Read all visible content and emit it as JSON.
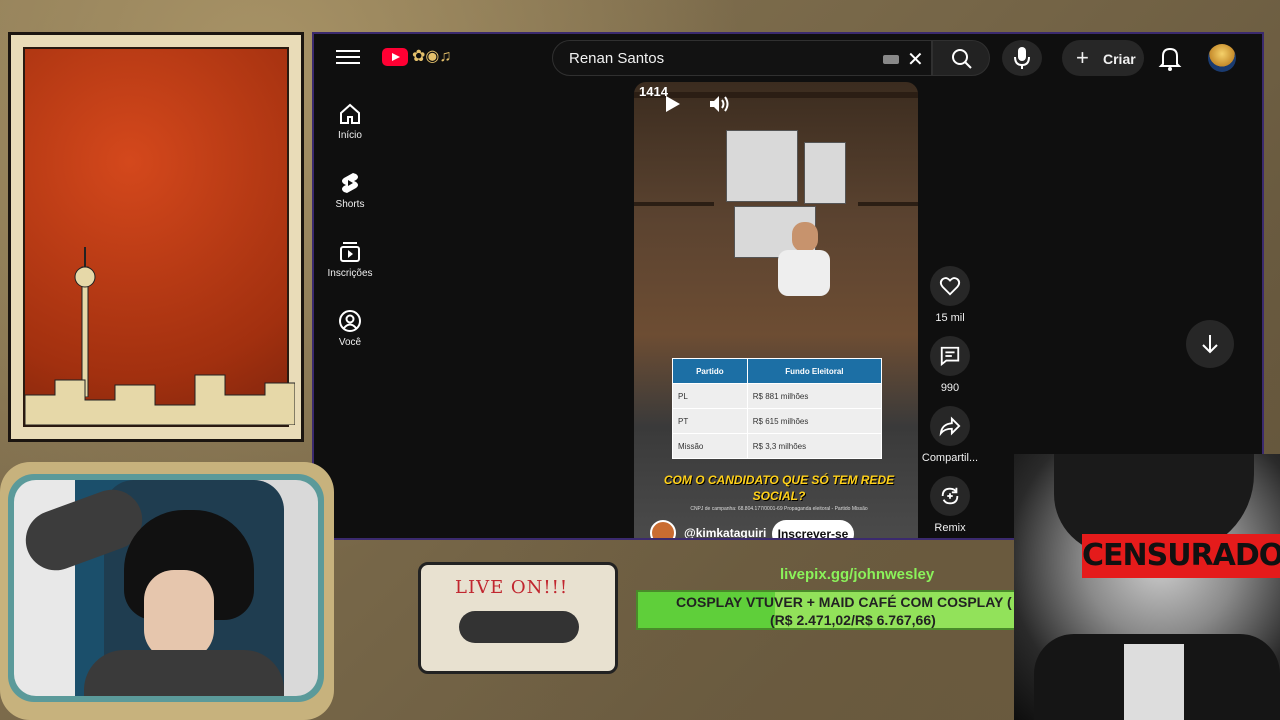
{
  "youtube": {
    "search": {
      "value": "Renan Santos"
    },
    "create_label": "Criar",
    "sidebar": [
      {
        "label": "Início",
        "icon": "home-icon"
      },
      {
        "label": "Shorts",
        "icon": "shorts-icon"
      },
      {
        "label": "Inscrições",
        "icon": "subscriptions-icon"
      },
      {
        "label": "Você",
        "icon": "you-icon"
      }
    ],
    "short": {
      "overlay_number": "1414",
      "table": {
        "headers": [
          "Partido",
          "Fundo Eleitoral"
        ],
        "rows": [
          [
            "PL",
            "R$ 881 milhões"
          ],
          [
            "PT",
            "R$ 615 milhões"
          ],
          [
            "Missão",
            "R$ 3,3 milhões"
          ]
        ]
      },
      "caption": "COM O CANDIDATO QUE SÓ TEM REDE SOCIAL?",
      "subcaption": "CNPJ de campanha: 68.804.177/0001-69 Propaganda eleitoral - Partido Missão",
      "channel": "@kimkataguiri",
      "subscribe_label": "Inscrever-se"
    },
    "actions": [
      {
        "label": "15 mil",
        "icon": "like-icon"
      },
      {
        "label": "990",
        "icon": "comment-icon"
      },
      {
        "label": "Compartil...",
        "icon": "share-icon"
      },
      {
        "label": "Remix",
        "icon": "remix-icon"
      }
    ]
  },
  "stream_overlay": {
    "tape_label": "LIVE ON!!!",
    "livepix_url": "livepix.gg/johnwesley",
    "goal": {
      "title": "COSPLAY VTUVER + MAID CAFÉ COM COSPLAY (",
      "amount": "(R$ 2.471,02/R$ 6.767,66)",
      "progress": 0.365
    },
    "censor_label": "CENSURADO"
  }
}
